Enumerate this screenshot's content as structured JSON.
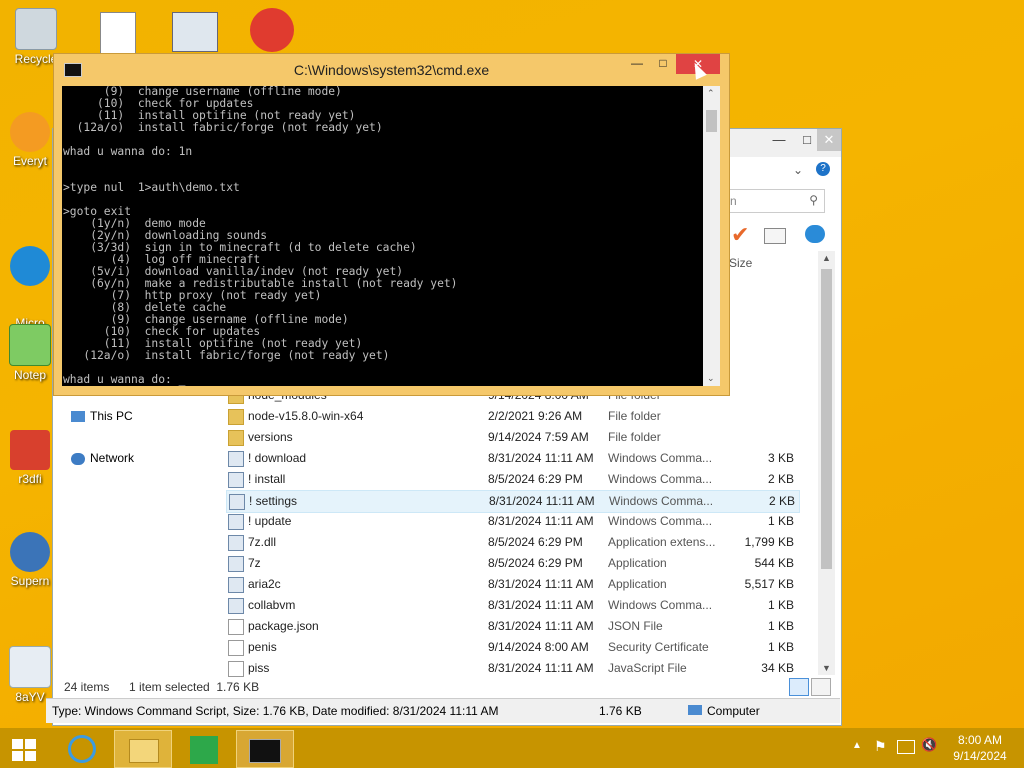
{
  "desktop": {
    "icons": [
      {
        "label": "Recycle"
      },
      {
        "label": "Everyt"
      },
      {
        "label": "Micro\nEdg"
      },
      {
        "label": "Notep"
      },
      {
        "label": "r3dfi"
      },
      {
        "label": "Supern"
      },
      {
        "label": "8aYV"
      }
    ]
  },
  "cmd": {
    "title": "C:\\Windows\\system32\\cmd.exe",
    "lines": [
      "      (9)  change username (offline mode)",
      "     (10)  check for updates",
      "     (11)  install optifine (not ready yet)",
      "  (12a/o)  install fabric/forge (not ready yet)",
      "",
      "whad u wanna do: 1n",
      "",
      "",
      ">type nul  1>auth\\demo.txt",
      "",
      ">goto exit",
      "    (1y/n)  demo mode",
      "    (2y/n)  downloading sounds",
      "    (3/3d)  sign in to minecraft (d to delete cache)",
      "       (4)  log off minecraft",
      "    (5v/i)  download vanilla/indev (not ready yet)",
      "    (6y/n)  make a redistributable install (not ready yet)",
      "       (7)  http proxy (not ready yet)",
      "       (8)  delete cache",
      "       (9)  change username (offline mode)",
      "      (10)  check for updates",
      "      (11)  install optifine (not ready yet)",
      "   (12a/o)  install fabric/forge (not ready yet)",
      "",
      "whad u wanna do: _"
    ]
  },
  "explorer": {
    "search_placeholder": "n",
    "size_header": "Size",
    "nav": [
      {
        "label": "This PC"
      },
      {
        "label": "Network"
      }
    ],
    "rows": [
      {
        "name": "node_modules",
        "date": "9/14/2024 8:00 AM",
        "type": "File folder",
        "size": "",
        "kind": "folder"
      },
      {
        "name": "node-v15.8.0-win-x64",
        "date": "2/2/2021 9:26 AM",
        "type": "File folder",
        "size": "",
        "kind": "folder"
      },
      {
        "name": "versions",
        "date": "9/14/2024 7:59 AM",
        "type": "File folder",
        "size": "",
        "kind": "folder"
      },
      {
        "name": "! download",
        "date": "8/31/2024 11:11 AM",
        "type": "Windows Comma...",
        "size": "3 KB",
        "kind": "app"
      },
      {
        "name": "! install",
        "date": "8/5/2024 6:29 PM",
        "type": "Windows Comma...",
        "size": "2 KB",
        "kind": "app"
      },
      {
        "name": "! settings",
        "date": "8/31/2024 11:11 AM",
        "type": "Windows Comma...",
        "size": "2 KB",
        "kind": "app"
      },
      {
        "name": "! update",
        "date": "8/31/2024 11:11 AM",
        "type": "Windows Comma...",
        "size": "1 KB",
        "kind": "app"
      },
      {
        "name": "7z.dll",
        "date": "8/5/2024 6:29 PM",
        "type": "Application extens...",
        "size": "1,799 KB",
        "kind": "app"
      },
      {
        "name": "7z",
        "date": "8/5/2024 6:29 PM",
        "type": "Application",
        "size": "544 KB",
        "kind": "app"
      },
      {
        "name": "aria2c",
        "date": "8/31/2024 11:11 AM",
        "type": "Application",
        "size": "5,517 KB",
        "kind": "app"
      },
      {
        "name": "collabvm",
        "date": "8/31/2024 11:11 AM",
        "type": "Windows Comma...",
        "size": "1 KB",
        "kind": "app"
      },
      {
        "name": "package.json",
        "date": "8/31/2024 11:11 AM",
        "type": "JSON File",
        "size": "1 KB",
        "kind": "doc"
      },
      {
        "name": "penis",
        "date": "9/14/2024 8:00 AM",
        "type": "Security Certificate",
        "size": "1 KB",
        "kind": "doc"
      },
      {
        "name": "piss",
        "date": "8/31/2024 11:11 AM",
        "type": "JavaScript File",
        "size": "34 KB",
        "kind": "doc"
      }
    ],
    "status_count": "24 items",
    "status_selected": "1 item selected  1.76 KB",
    "details_bar": "Type: Windows Command Script, Size: 1.76 KB, Date modified: 8/31/2024 11:11 AM",
    "details_size": "1.76 KB",
    "details_location": "Computer"
  },
  "taskbar": {
    "time": "8:00 AM",
    "date": "9/14/2024"
  },
  "colors": {
    "desktop": "#f2b300",
    "taskbar": "#c79400",
    "cmd_frame": "#f5c86a",
    "close_red": "#e04343"
  }
}
